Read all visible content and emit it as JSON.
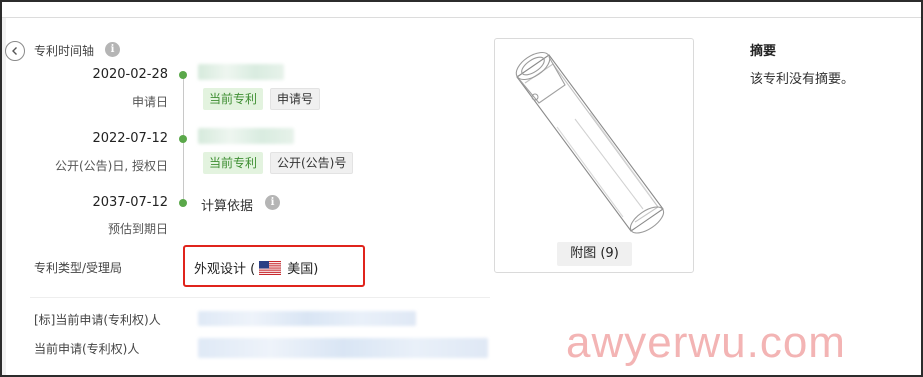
{
  "nav": {
    "back_icon": "chevron-left-icon"
  },
  "timeline": {
    "title": "专利时间轴",
    "info_icon": "info-icon",
    "events": [
      {
        "date": "2020-02-28",
        "sub": "申请日",
        "tags": [
          "当前专利",
          "申请号"
        ]
      },
      {
        "date": "2022-07-12",
        "sub": "公开(公告)日, 授权日",
        "tags": [
          "当前专利",
          "公开(公告)号"
        ]
      },
      {
        "date": "2037-07-12",
        "sub": "预估到期日",
        "calc_label": "计算依据"
      }
    ]
  },
  "patent_type": {
    "label": "专利类型/受理局",
    "value": "外观设计 (",
    "country": "美国)",
    "flag_icon": "us-flag-icon"
  },
  "applicants": {
    "tagged_label": "[标]当前申请(专利权)人",
    "current_label": "当前申请(专利权)人"
  },
  "figure": {
    "caption": "附图 (9)"
  },
  "abstract": {
    "heading": "摘要",
    "text": "该专利没有摘要。"
  },
  "watermark": "awyerwu.com",
  "colors": {
    "accent_green": "#5aa84a",
    "highlight_red": "#e0241c",
    "tag_green_bg": "#e3f3df"
  }
}
